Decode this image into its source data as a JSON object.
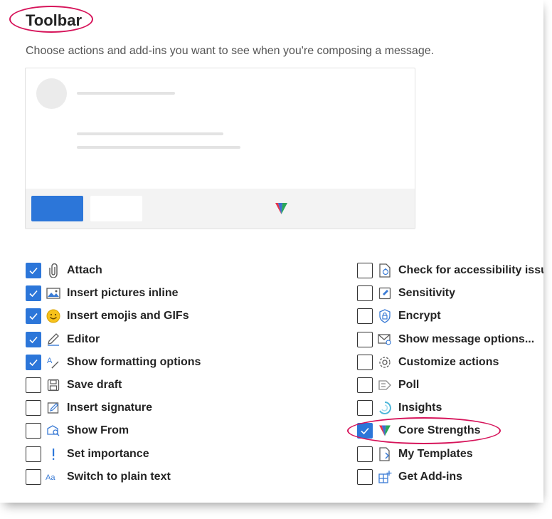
{
  "toolbar": {
    "title": "Toolbar",
    "subtitle": "Choose actions and add-ins you want to see when you're composing a message."
  },
  "colors": {
    "accent": "#2c76d9",
    "highlight_ring": "#d6145a"
  },
  "options_left": [
    {
      "label": "Attach",
      "checked": true,
      "icon": "paperclip-icon"
    },
    {
      "label": "Insert pictures inline",
      "checked": true,
      "icon": "image-icon"
    },
    {
      "label": "Insert emojis and GIFs",
      "checked": true,
      "icon": "emoji-icon"
    },
    {
      "label": "Editor",
      "checked": true,
      "icon": "editor-pen-icon"
    },
    {
      "label": "Show formatting options",
      "checked": true,
      "icon": "text-format-icon"
    },
    {
      "label": "Save draft",
      "checked": false,
      "icon": "save-icon"
    },
    {
      "label": "Insert signature",
      "checked": false,
      "icon": "signature-icon"
    },
    {
      "label": "Show From",
      "checked": false,
      "icon": "show-from-icon"
    },
    {
      "label": "Set importance",
      "checked": false,
      "icon": "exclamation-icon"
    },
    {
      "label": "Switch to plain text",
      "checked": false,
      "icon": "plain-text-icon"
    }
  ],
  "options_right": [
    {
      "label": "Check for accessibility issues",
      "checked": false,
      "icon": "accessibility-icon"
    },
    {
      "label": "Sensitivity",
      "checked": false,
      "icon": "sensitivity-icon"
    },
    {
      "label": "Encrypt",
      "checked": false,
      "icon": "encrypt-lock-icon"
    },
    {
      "label": "Show message options...",
      "checked": false,
      "icon": "message-options-icon"
    },
    {
      "label": "Customize actions",
      "checked": false,
      "icon": "gear-icon"
    },
    {
      "label": "Poll",
      "checked": false,
      "icon": "poll-icon"
    },
    {
      "label": "Insights",
      "checked": false,
      "icon": "insights-icon"
    },
    {
      "label": "Core Strengths",
      "checked": true,
      "icon": "core-strengths-logo-icon"
    },
    {
      "label": "My Templates",
      "checked": false,
      "icon": "templates-icon"
    },
    {
      "label": "Get Add-ins",
      "checked": false,
      "icon": "add-ins-icon"
    }
  ]
}
